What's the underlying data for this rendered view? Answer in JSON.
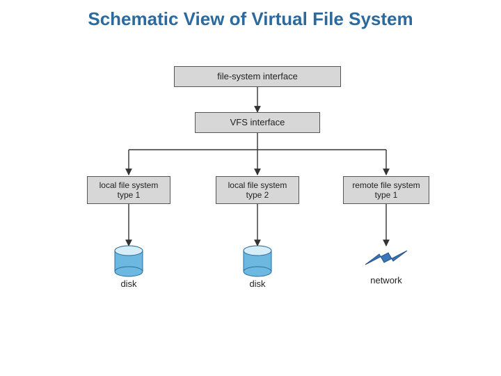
{
  "title": "Schematic View of Virtual File System",
  "nodes": {
    "fs_interface": "file-system interface",
    "vfs_interface": "VFS interface",
    "local_fs_1": "local file system\ntype 1",
    "local_fs_2": "local file system\ntype 2",
    "remote_fs_1": "remote file system\ntype 1",
    "disk1": "disk",
    "disk2": "disk",
    "network": "network"
  },
  "edges": [
    [
      "fs_interface",
      "vfs_interface"
    ],
    [
      "vfs_interface",
      "local_fs_1"
    ],
    [
      "vfs_interface",
      "local_fs_2"
    ],
    [
      "vfs_interface",
      "remote_fs_1"
    ],
    [
      "local_fs_1",
      "disk1"
    ],
    [
      "local_fs_2",
      "disk2"
    ],
    [
      "remote_fs_1",
      "network"
    ]
  ],
  "colors": {
    "title": "#2b6a9e",
    "boxFill": "#d7d7d7",
    "diskFill": "#6db8e0",
    "diskStroke": "#2a6d9c",
    "networkStroke": "#3a76b8"
  }
}
